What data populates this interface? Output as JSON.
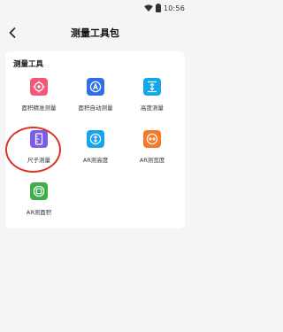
{
  "status_bar": {
    "time": "10:56"
  },
  "header": {
    "title": "测量工具包"
  },
  "section": {
    "title": "测量工具"
  },
  "tools": [
    {
      "label": "面积精准测量",
      "color": "#ef5a78",
      "icon": "target-icon"
    },
    {
      "label": "面积自动测量",
      "color": "#2f6fe6",
      "icon": "auto-a-icon"
    },
    {
      "label": "高度测量",
      "color": "#12a8e8",
      "icon": "height-icon"
    },
    {
      "label": "尺子测量",
      "color": "#7b5de6",
      "icon": "ruler-icon"
    },
    {
      "label": "AR测高度",
      "color": "#14a5ec",
      "icon": "ar-height-icon"
    },
    {
      "label": "AR测宽度",
      "color": "#f47a2a",
      "icon": "ar-width-icon"
    },
    {
      "label": "AR测面积",
      "color": "#3fae4a",
      "icon": "ar-area-icon"
    }
  ],
  "colors": {
    "highlight": "#d9362b",
    "background": "#f5f5f7",
    "card": "#ffffff"
  }
}
